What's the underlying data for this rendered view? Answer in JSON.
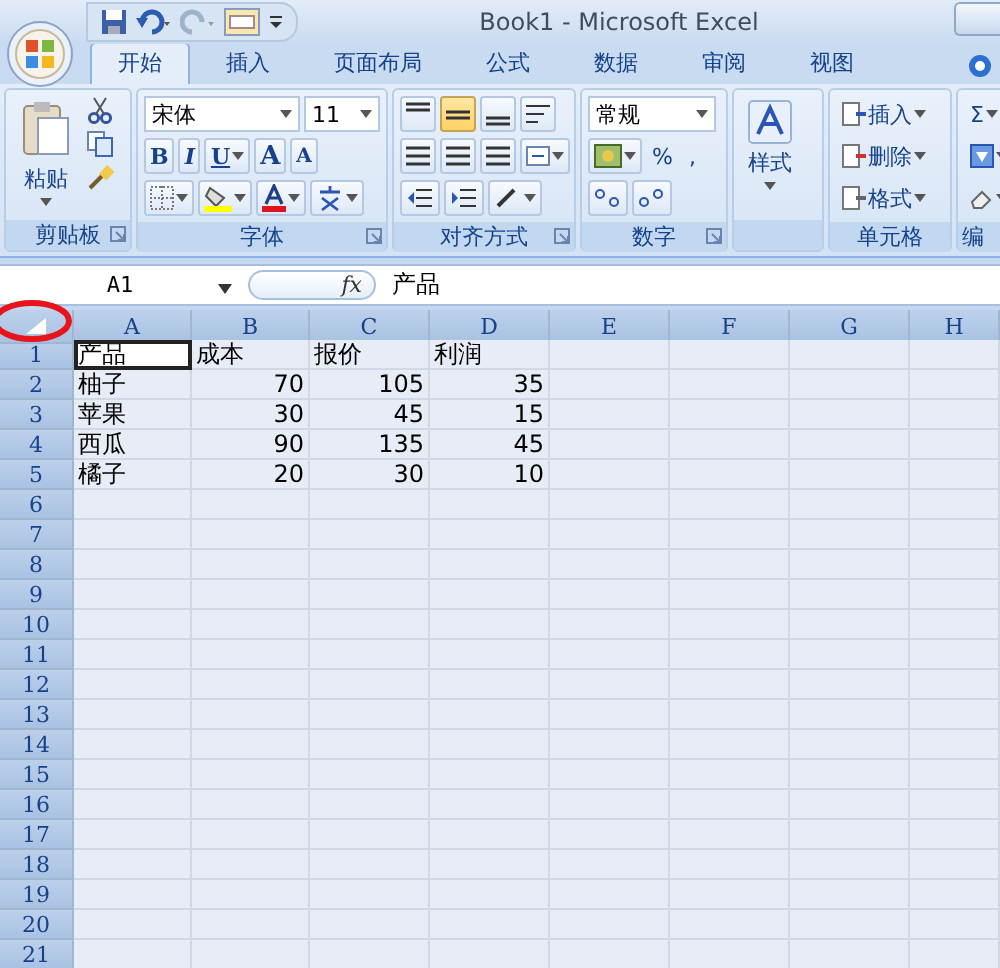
{
  "window": {
    "title": "Book1 - Microsoft Excel"
  },
  "tabs": [
    {
      "label": "开始",
      "selected": true
    },
    {
      "label": "插入",
      "selected": false
    },
    {
      "label": "页面布局",
      "selected": false
    },
    {
      "label": "公式",
      "selected": false
    },
    {
      "label": "数据",
      "selected": false
    },
    {
      "label": "审阅",
      "selected": false
    },
    {
      "label": "视图",
      "selected": false
    }
  ],
  "ribbon": {
    "clipboard": {
      "label": "剪贴板",
      "paste": "粘贴"
    },
    "font": {
      "label": "字体",
      "face": "宋体",
      "size": "11",
      "bold": "B",
      "italic": "I",
      "underline": "U",
      "grow": "A",
      "shrink": "A"
    },
    "alignment": {
      "label": "对齐方式",
      "buttons": [
        {
          "kind": "top",
          "selected": false
        },
        {
          "kind": "middle",
          "selected": true
        },
        {
          "kind": "bottom",
          "selected": false
        }
      ]
    },
    "number": {
      "label": "数字",
      "format": "常规",
      "percent": "%",
      "comma": ","
    },
    "styles": {
      "button": "样式"
    },
    "cells": {
      "label": "单元格",
      "insert": "插入",
      "delete": "删除",
      "format": "格式"
    },
    "editing": {
      "label": "编",
      "sum": "Σ"
    }
  },
  "formula_bar": {
    "name_box": "A1",
    "fx": "fx",
    "value": "产品"
  },
  "sheet": {
    "all_selected": true,
    "corner_circled": true,
    "columns": [
      "A",
      "B",
      "C",
      "D",
      "E",
      "F",
      "G",
      "H"
    ],
    "rows": [
      {
        "header": "1",
        "cells": [
          {
            "text": "产品",
            "kind": "text",
            "active": true
          },
          {
            "text": "成本",
            "kind": "text",
            "active": false
          },
          {
            "text": "报价",
            "kind": "text",
            "active": false
          },
          {
            "text": "利润",
            "kind": "text",
            "active": false
          }
        ]
      },
      {
        "header": "2",
        "cells": [
          {
            "text": "柚子",
            "kind": "text",
            "active": false
          },
          {
            "text": "70",
            "kind": "number",
            "active": false
          },
          {
            "text": "105",
            "kind": "number",
            "active": false
          },
          {
            "text": "35",
            "kind": "number",
            "active": false
          }
        ]
      },
      {
        "header": "3",
        "cells": [
          {
            "text": "苹果",
            "kind": "text",
            "active": false
          },
          {
            "text": "30",
            "kind": "number",
            "active": false
          },
          {
            "text": "45",
            "kind": "number",
            "active": false
          },
          {
            "text": "15",
            "kind": "number",
            "active": false
          }
        ]
      },
      {
        "header": "4",
        "cells": [
          {
            "text": "西瓜",
            "kind": "text",
            "active": false
          },
          {
            "text": "90",
            "kind": "number",
            "active": false
          },
          {
            "text": "135",
            "kind": "number",
            "active": false
          },
          {
            "text": "45",
            "kind": "number",
            "active": false
          }
        ]
      },
      {
        "header": "5",
        "cells": [
          {
            "text": "橘子",
            "kind": "text",
            "active": false
          },
          {
            "text": "20",
            "kind": "number",
            "active": false
          },
          {
            "text": "30",
            "kind": "number",
            "active": false
          },
          {
            "text": "10",
            "kind": "number",
            "active": false
          }
        ]
      },
      {
        "header": "6"
      },
      {
        "header": "7"
      },
      {
        "header": "8"
      },
      {
        "header": "9"
      },
      {
        "header": "10"
      },
      {
        "header": "11"
      },
      {
        "header": "12"
      },
      {
        "header": "13"
      },
      {
        "header": "14"
      },
      {
        "header": "15"
      },
      {
        "header": "16"
      },
      {
        "header": "17"
      },
      {
        "header": "18"
      },
      {
        "header": "19"
      },
      {
        "header": "20"
      },
      {
        "header": "21"
      }
    ]
  }
}
